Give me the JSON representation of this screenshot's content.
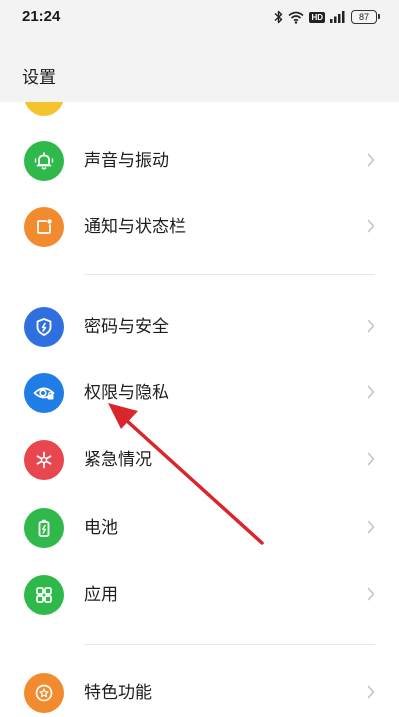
{
  "status_bar": {
    "time": "21:24",
    "hd_label": "HD",
    "battery_level": "87",
    "icons": [
      "bluetooth-icon",
      "wifi-icon",
      "hd-icon",
      "signal-icon",
      "battery-icon"
    ]
  },
  "header": {
    "title": "设置"
  },
  "settings": {
    "items": [
      {
        "label": "声音与振动",
        "icon": "bell-icon",
        "color": "#2fb94a"
      },
      {
        "label": "通知与状态栏",
        "icon": "notification-icon",
        "color": "#f28a2e"
      },
      {
        "label": "密码与安全",
        "icon": "shield-icon",
        "color": "#2f6fe0"
      },
      {
        "label": "权限与隐私",
        "icon": "privacy-eye-icon",
        "color": "#1f7de6"
      },
      {
        "label": "紧急情况",
        "icon": "emergency-icon",
        "color": "#e8474f"
      },
      {
        "label": "电池",
        "icon": "battery-icon",
        "color": "#2fb94a"
      },
      {
        "label": "应用",
        "icon": "apps-grid-icon",
        "color": "#2fb94a"
      },
      {
        "label": "特色功能",
        "icon": "star-icon",
        "color": "#f28a2e"
      }
    ]
  },
  "annotation": {
    "arrow_color": "#d9262c"
  }
}
